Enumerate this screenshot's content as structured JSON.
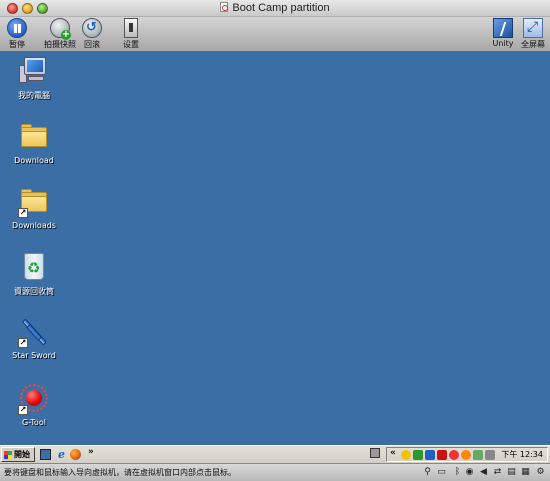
{
  "window": {
    "title": "Boot Camp partition"
  },
  "toolbar": {
    "pause_label": "暂停",
    "snapshot_label": "拍摄快照",
    "revert_label": "回滚",
    "settings_label": "设置",
    "unity_label": "Unity",
    "fullscreen_label": "全屏幕"
  },
  "desktop": {
    "icons": [
      {
        "label": "我的電腦",
        "icon": "computer-icon",
        "shortcut": false
      },
      {
        "label": "Download",
        "icon": "folder-icon",
        "shortcut": false
      },
      {
        "label": "Downloads",
        "icon": "folder-icon",
        "shortcut": true
      },
      {
        "label": "資源回收筒",
        "icon": "recycle-bin-icon",
        "shortcut": false
      },
      {
        "label": "Star Sword",
        "icon": "sword-icon",
        "shortcut": true
      },
      {
        "label": "G-Tool",
        "icon": "red-dot-icon",
        "shortcut": true
      }
    ],
    "background_color": "#3a6ea5"
  },
  "taskbar": {
    "start_label": "開始",
    "quick_launch_more": "»",
    "tray_expand": "«",
    "clock": "下午 12:34"
  },
  "statusbar": {
    "message": "要将键盘和鼠标输入导向虚拟机，请在虚拟机窗口内部点击鼠标。"
  }
}
